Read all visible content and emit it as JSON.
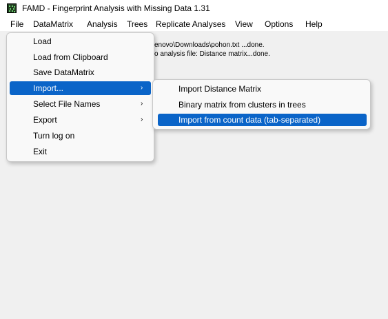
{
  "window": {
    "title": "FAMD - Fingerprint Analysis with Missing Data 1.31",
    "icon": "famd-app-icon"
  },
  "menubar": {
    "items": [
      "File",
      "DataMatrix",
      "Analysis",
      "Trees",
      "Replicate Analyses",
      "View",
      "Options",
      "Help"
    ]
  },
  "log": {
    "line1": "enovo\\Downloads\\pohon.txt ...done.",
    "line2": "o analysis file:  Distance matrix...done."
  },
  "datamatrix_menu": {
    "items": [
      {
        "label": "Load",
        "has_submenu": false
      },
      {
        "label": "Load from Clipboard",
        "has_submenu": false
      },
      {
        "label": "Save DataMatrix",
        "has_submenu": false
      },
      {
        "label": "Import...",
        "has_submenu": true,
        "highlighted": true
      },
      {
        "label": "Select File Names",
        "has_submenu": true
      },
      {
        "label": "Export",
        "has_submenu": true
      },
      {
        "label": "Turn log on",
        "has_submenu": false
      },
      {
        "label": "Exit",
        "has_submenu": false
      }
    ],
    "arrow_glyph": "›"
  },
  "import_submenu": {
    "items": [
      {
        "label": "Import Distance Matrix"
      },
      {
        "label": "Binary matrix from clusters in trees"
      },
      {
        "label": "Import from count data (tab-separated)",
        "highlighted": true
      }
    ]
  },
  "colors": {
    "highlight": "#0a64c8",
    "menu_bg": "#f9f9f9",
    "client_bg": "#f0f0f0"
  }
}
